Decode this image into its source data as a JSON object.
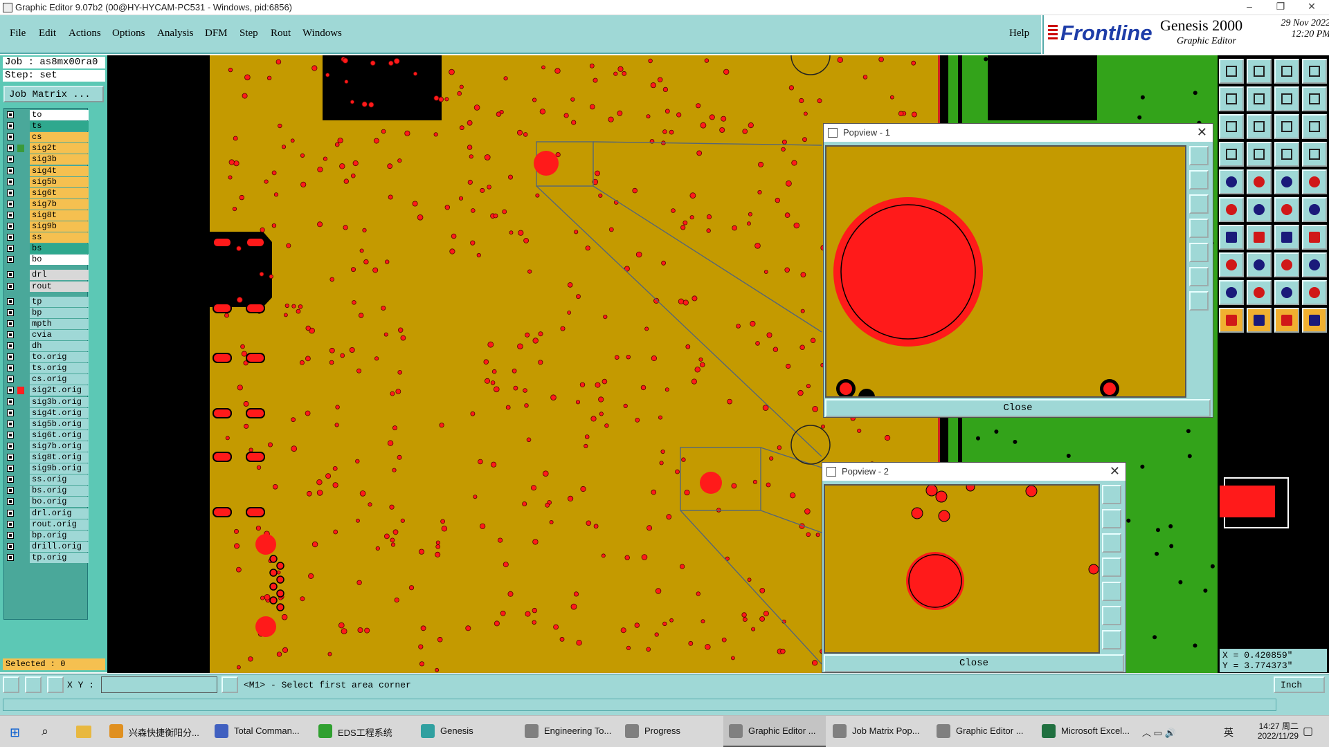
{
  "window": {
    "title": "Graphic Editor 9.07b2 (00@HY-HYCAM-PC531 - Windows, pid:6856)"
  },
  "menu": {
    "items": [
      "File",
      "Edit",
      "Actions",
      "Options",
      "Analysis",
      "DFM",
      "Step",
      "Rout",
      "Windows"
    ],
    "help": "Help"
  },
  "brand": {
    "logo": "Frontline",
    "product": "Genesis 2000",
    "subtitle": "Graphic Editor",
    "date": "29 Nov 2022",
    "time": "12:20 PM"
  },
  "job": {
    "job_label": "Job : as8mx00ra0",
    "step_label": "Step: set",
    "matrix_button": "Job Matrix ..."
  },
  "layers": [
    {
      "name": "to",
      "color": "#ffffff"
    },
    {
      "name": "ts",
      "color": "#2fa88e"
    },
    {
      "name": "cs",
      "color": "#f5c050"
    },
    {
      "name": "sig2t",
      "color": "#f5c050",
      "marker": "#3a9a3a"
    },
    {
      "name": "sig3b",
      "color": "#f5c050"
    },
    {
      "name": "sig4t",
      "color": "#f5c050"
    },
    {
      "name": "sig5b",
      "color": "#f5c050"
    },
    {
      "name": "sig6t",
      "color": "#f5c050"
    },
    {
      "name": "sig7b",
      "color": "#f5c050"
    },
    {
      "name": "sig8t",
      "color": "#f5c050"
    },
    {
      "name": "sig9b",
      "color": "#f5c050"
    },
    {
      "name": "ss",
      "color": "#f5c050"
    },
    {
      "name": "bs",
      "color": "#2fa88e"
    },
    {
      "name": "bo",
      "color": "#ffffff"
    },
    {
      "name": "drl",
      "color": "#d8d8d8"
    },
    {
      "name": "rout",
      "color": "#d8d8d8"
    },
    {
      "name": "tp",
      "color": "#9fd8d6"
    },
    {
      "name": "bp",
      "color": "#9fd8d6"
    },
    {
      "name": "mpth",
      "color": "#9fd8d6"
    },
    {
      "name": "cvia",
      "color": "#9fd8d6"
    },
    {
      "name": "dh",
      "color": "#9fd8d6"
    },
    {
      "name": "to.orig",
      "color": "#9fd8d6"
    },
    {
      "name": "ts.orig",
      "color": "#9fd8d6"
    },
    {
      "name": "cs.orig",
      "color": "#9fd8d6"
    },
    {
      "name": "sig2t.orig",
      "color": "#9fd8d6",
      "marker": "#ff2020"
    },
    {
      "name": "sig3b.orig",
      "color": "#9fd8d6"
    },
    {
      "name": "sig4t.orig",
      "color": "#9fd8d6"
    },
    {
      "name": "sig5b.orig",
      "color": "#9fd8d6"
    },
    {
      "name": "sig6t.orig",
      "color": "#9fd8d6"
    },
    {
      "name": "sig7b.orig",
      "color": "#9fd8d6"
    },
    {
      "name": "sig8t.orig",
      "color": "#9fd8d6"
    },
    {
      "name": "sig9b.orig",
      "color": "#9fd8d6"
    },
    {
      "name": "ss.orig",
      "color": "#9fd8d6"
    },
    {
      "name": "bs.orig",
      "color": "#9fd8d6"
    },
    {
      "name": "bo.orig",
      "color": "#9fd8d6"
    },
    {
      "name": "drl.orig",
      "color": "#9fd8d6"
    },
    {
      "name": "rout.orig",
      "color": "#9fd8d6"
    },
    {
      "name": "bp.orig",
      "color": "#9fd8d6"
    },
    {
      "name": "drill.orig",
      "color": "#9fd8d6"
    },
    {
      "name": "tp.orig",
      "color": "#9fd8d6"
    }
  ],
  "selected": "Selected : 0",
  "popview1": {
    "title": "Popview - 1",
    "close": "Close"
  },
  "popview2": {
    "title": "Popview - 2",
    "close": "Close"
  },
  "coords": {
    "x": "X = 0.420859\"",
    "y": "Y = 3.774373\""
  },
  "status": {
    "xy_label": "X Y :",
    "xy_value": "",
    "prompt": "<M1> - Select first area corner",
    "unit": "Inch"
  },
  "colors": {
    "board": "#c49a00",
    "pad": "#ff1a1a",
    "green": "#33a31a",
    "panel": "#9fd8d6"
  },
  "taskbar": {
    "items": [
      {
        "label": "兴森快捷衡阳分...",
        "color": "#e09020"
      },
      {
        "label": "Total Comman...",
        "color": "#4060c0"
      },
      {
        "label": "EDS工程系统",
        "color": "#30a030"
      },
      {
        "label": "Genesis",
        "color": "#30a0a0"
      },
      {
        "label": "Engineering To...",
        "color": "#808080"
      },
      {
        "label": "Progress",
        "color": "#808080"
      },
      {
        "label": "Graphic Editor ...",
        "color": "#808080"
      },
      {
        "label": "Job Matrix Pop...",
        "color": "#808080"
      },
      {
        "label": "Graphic Editor ...",
        "color": "#808080"
      },
      {
        "label": "Microsoft Excel...",
        "color": "#207040"
      }
    ],
    "tray_lang": "英",
    "time": "14:27 周二",
    "date": "2022/11/29"
  }
}
